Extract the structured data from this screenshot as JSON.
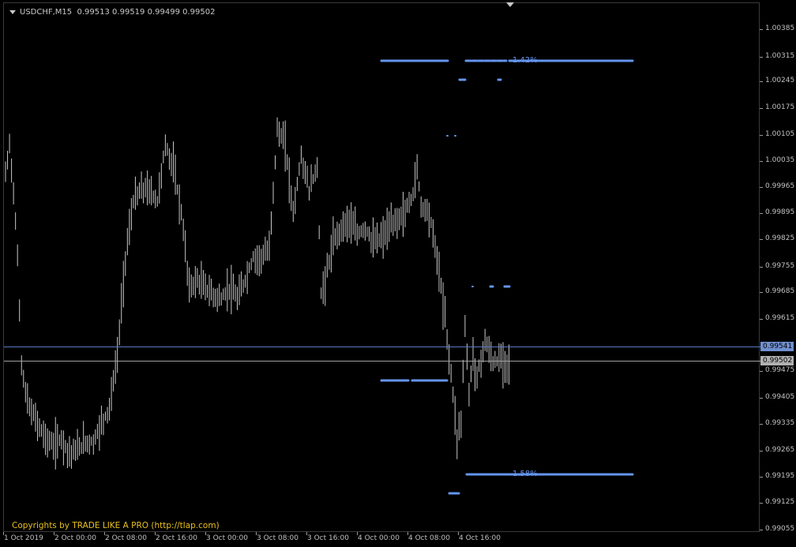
{
  "header": {
    "symbol_timeframe": "USDCHF,M15",
    "ohlc": "0.99513 0.99519 0.99499 0.99502"
  },
  "copyright": "Copyrights by TRADE LIKE A PRO (http://tlap.com)",
  "price_axis": {
    "labels": [
      "1.00385",
      "1.00315",
      "1.00245",
      "1.00175",
      "1.00105",
      "1.00035",
      "0.99965",
      "0.99895",
      "0.99825",
      "0.99755",
      "0.99685",
      "0.99615",
      "0.99541",
      "0.99502",
      "0.99475",
      "0.99405",
      "0.99335",
      "0.99265",
      "0.99195",
      "0.99125",
      "0.99055"
    ]
  },
  "time_axis": {
    "labels": [
      "1 Oct 2019",
      "2 Oct 00:00",
      "2 Oct 08:00",
      "2 Oct 16:00",
      "3 Oct 00:00",
      "3 Oct 08:00",
      "3 Oct 16:00",
      "4 Oct 00:00",
      "4 Oct 08:00",
      "4 Oct 16:00"
    ]
  },
  "price_lines": {
    "ask": {
      "value": "0.99541",
      "color": "#6f8fcf"
    },
    "bid": {
      "value": "0.99502",
      "color": "#b0b0b0"
    }
  },
  "annotations": {
    "upper_pct": "1.42%",
    "lower_pct": "1.58%"
  },
  "colors": {
    "background": "#000000",
    "candles": "#c8c8c8",
    "levels": "#6495ed",
    "copyright": "#e8c020"
  },
  "chart_data": {
    "type": "bar",
    "symbol": "USDCHF",
    "timeframe": "M15",
    "ylim": [
      0.9902,
      1.0042
    ],
    "x_labels": [
      "1 Oct 2019",
      "2 Oct 00:00",
      "2 Oct 08:00",
      "2 Oct 16:00",
      "3 Oct 00:00",
      "3 Oct 08:00",
      "3 Oct 16:00",
      "4 Oct 00:00",
      "4 Oct 08:00",
      "4 Oct 16:00"
    ],
    "price_path": [
      [
        0,
        1.0
      ],
      [
        2,
        1.0008
      ],
      [
        4,
        0.9996
      ],
      [
        6,
        0.9978
      ],
      [
        8,
        0.995
      ],
      [
        10,
        0.9942
      ],
      [
        12,
        0.9938
      ],
      [
        16,
        0.9934
      ],
      [
        20,
        0.993
      ],
      [
        24,
        0.9928
      ],
      [
        28,
        0.993
      ],
      [
        32,
        0.9926
      ],
      [
        36,
        0.9927
      ],
      [
        40,
        0.9929
      ],
      [
        44,
        0.9929
      ],
      [
        48,
        0.9934
      ],
      [
        52,
        0.9938
      ],
      [
        56,
        0.9952
      ],
      [
        60,
        0.9978
      ],
      [
        64,
        0.9993
      ],
      [
        68,
        0.9996
      ],
      [
        72,
        0.9996
      ],
      [
        76,
        0.9993
      ],
      [
        80,
        1.0008
      ],
      [
        84,
        1.0002
      ],
      [
        88,
        0.999
      ],
      [
        92,
        0.997
      ],
      [
        96,
        0.9972
      ],
      [
        100,
        0.997
      ],
      [
        104,
        0.9968
      ],
      [
        108,
        0.9967
      ],
      [
        112,
        0.997
      ],
      [
        116,
        0.9967
      ],
      [
        120,
        0.9972
      ],
      [
        124,
        0.9978
      ],
      [
        128,
        0.9978
      ],
      [
        132,
        0.998
      ],
      [
        136,
        1.0012
      ],
      [
        140,
        1.0008
      ],
      [
        144,
        0.999
      ],
      [
        148,
        1.0005
      ],
      [
        152,
        0.9996
      ],
      [
        156,
        1.0002
      ],
      [
        158,
        0.9968
      ],
      [
        160,
        0.9972
      ],
      [
        164,
        0.9982
      ],
      [
        168,
        0.9986
      ],
      [
        172,
        0.9988
      ],
      [
        176,
        0.9984
      ],
      [
        180,
        0.9986
      ],
      [
        184,
        0.9982
      ],
      [
        188,
        0.9983
      ],
      [
        192,
        0.9986
      ],
      [
        196,
        0.9988
      ],
      [
        200,
        0.999
      ],
      [
        204,
        0.9995
      ],
      [
        206,
        1.0002
      ],
      [
        208,
        0.9992
      ],
      [
        212,
        0.999
      ],
      [
        216,
        0.9978
      ],
      [
        220,
        0.9962
      ],
      [
        224,
        0.9942
      ],
      [
        226,
        0.993
      ],
      [
        228,
        0.9935
      ],
      [
        230,
        0.996
      ],
      [
        232,
        0.9942
      ],
      [
        234,
        0.9952
      ],
      [
        236,
        0.9946
      ],
      [
        240,
        0.9956
      ],
      [
        244,
        0.995
      ],
      [
        248,
        0.9951
      ],
      [
        252,
        0.995
      ]
    ],
    "levels": [
      {
        "price": 1.00315,
        "from": "4 Oct 00:00",
        "to": "end",
        "label": "1.42%"
      },
      {
        "price": 0.99195,
        "from": "4 Oct 08:00",
        "to": "end",
        "label": "1.58%"
      },
      {
        "price": 0.9945,
        "from": "4 Oct 00:00",
        "to": "4 Oct 08:00",
        "label": ""
      }
    ],
    "ask": 0.99541,
    "bid": 0.99502
  }
}
